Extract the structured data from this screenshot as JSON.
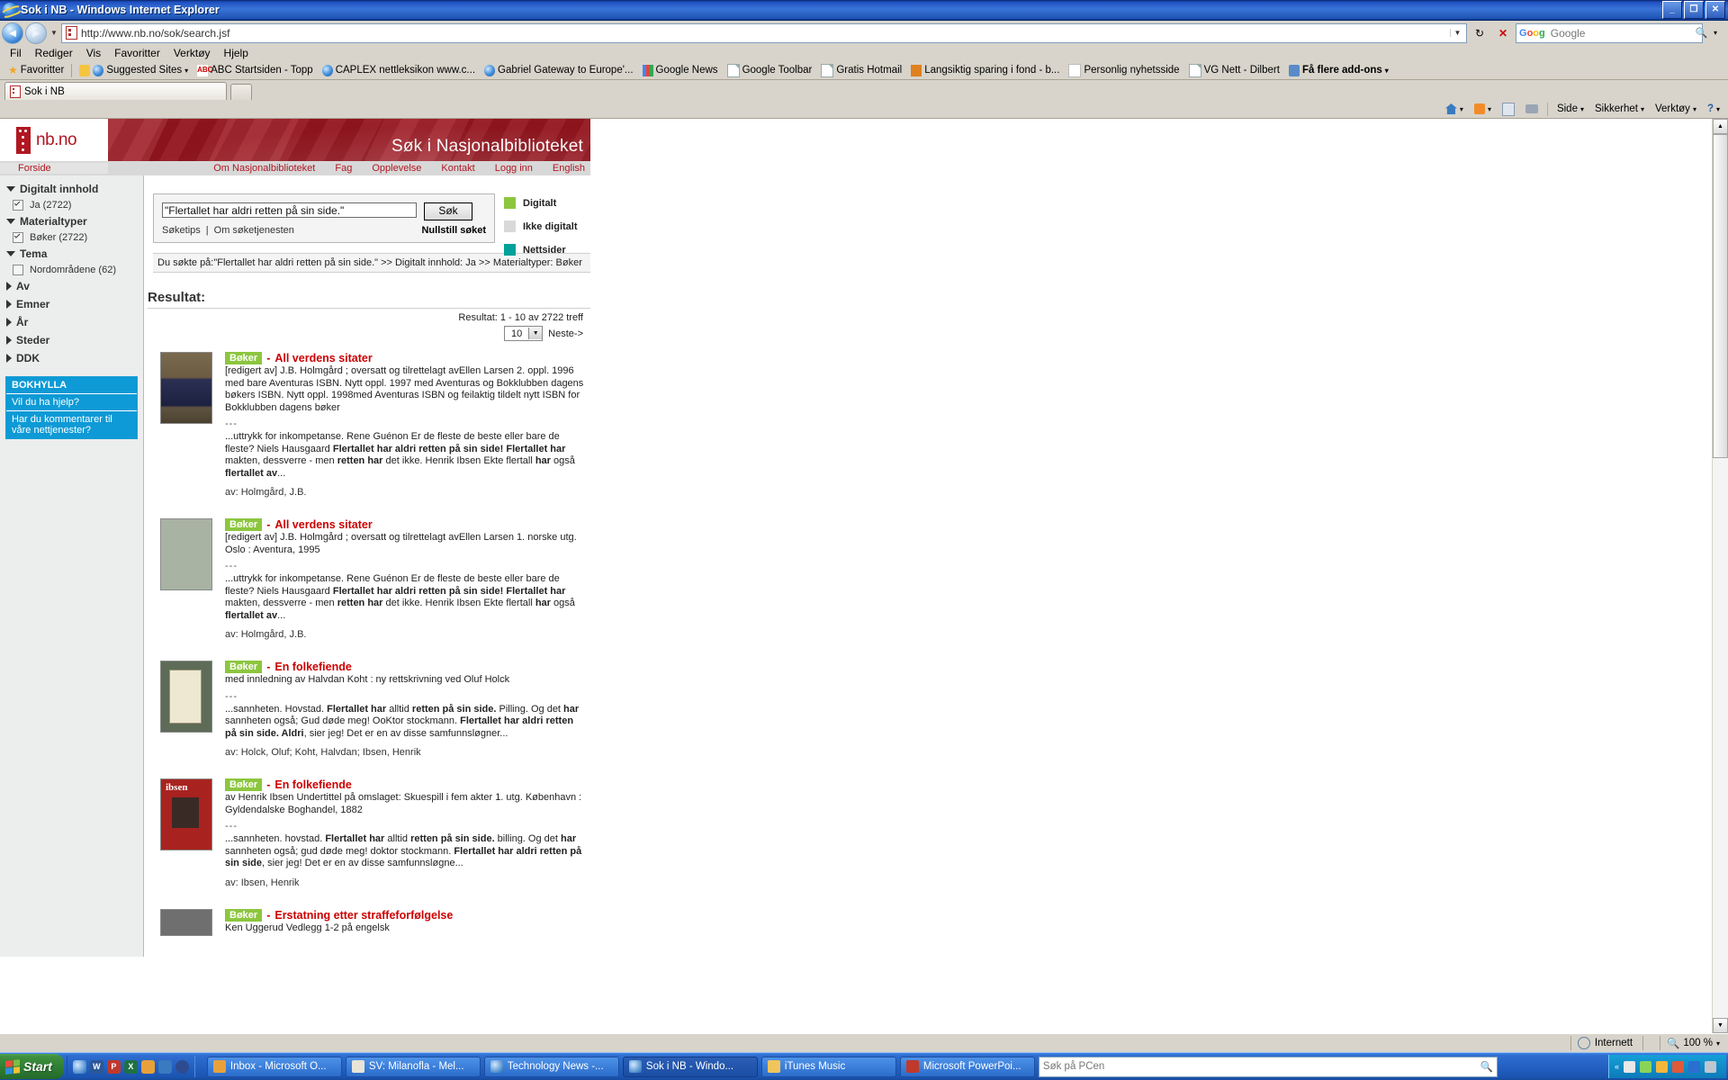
{
  "window": {
    "title": "Sok i NB - Windows Internet Explorer",
    "minimize": "_",
    "maximize": "❐",
    "close": "✕"
  },
  "address": {
    "url_prefix": "http://www.",
    "url_domain": "nb.no",
    "url_path": "/sok/search.jsf",
    "full_url": "http://www.nb.no/sok/search.jsf",
    "dropdown_arrow": "▼",
    "refresh": "↻",
    "stop": "✕"
  },
  "browser_search": {
    "placeholder": "Google",
    "value": "Google"
  },
  "menu": [
    "Fil",
    "Rediger",
    "Vis",
    "Favoritter",
    "Verktøy",
    "Hjelp"
  ],
  "favorites_bar": {
    "favorites_label": "Favoritter",
    "items": [
      {
        "label": "Suggested Sites",
        "icon": "ie-icon",
        "caret": "▾"
      },
      {
        "label": "ABC Startsiden - Topp",
        "icon": "abc-icon"
      },
      {
        "label": "CAPLEX nettleksikon www.c...",
        "icon": "ie-icon"
      },
      {
        "label": "Gabriel  Gateway to Europe'...",
        "icon": "ie-icon"
      },
      {
        "label": "Google News",
        "icon": "google-icon"
      },
      {
        "label": "Google Toolbar",
        "icon": "doc-icon"
      },
      {
        "label": "Gratis Hotmail",
        "icon": "doc-icon"
      },
      {
        "label": "Langsiktig sparing i fond - b...",
        "icon": "hotmail-icon"
      },
      {
        "label": "Personlig nyhetsside",
        "icon": "doc-icon"
      },
      {
        "label": "VG Nett - Dilbert",
        "icon": "doc-icon"
      },
      {
        "label": "Få flere add-ons",
        "icon": "addons-icon",
        "caret": "▾",
        "bold": true
      }
    ]
  },
  "tabs": [
    {
      "label": "Sok i NB",
      "active": true
    }
  ],
  "command_bar": {
    "home": "Side",
    "security": "Sikkerhet",
    "tools": "Verktøy",
    "help_caret": "▾",
    "page_caret": "▾"
  },
  "site": {
    "logo_text": "nb.no",
    "hero_title": "Søk i Nasjonalbiblioteket",
    "nav_left": "Forside",
    "nav_links": [
      "Om Nasjonalbiblioteket",
      "Fag",
      "Opplevelse",
      "Kontakt",
      "Logg inn",
      "English"
    ]
  },
  "sidebar": {
    "groups": [
      {
        "label": "Digitalt innhold",
        "expanded": true,
        "items": [
          {
            "label": "Ja (2722)",
            "checked": true
          }
        ]
      },
      {
        "label": "Materialtyper",
        "expanded": true,
        "items": [
          {
            "label": "Bøker (2722)",
            "checked": true
          }
        ]
      },
      {
        "label": "Tema",
        "expanded": true,
        "items": [
          {
            "label": "Nordområdene (62)",
            "checked": false
          }
        ]
      },
      {
        "label": "Av",
        "expanded": false,
        "items": []
      },
      {
        "label": "Emner",
        "expanded": false,
        "items": []
      },
      {
        "label": "År",
        "expanded": false,
        "items": []
      },
      {
        "label": "Steder",
        "expanded": false,
        "items": []
      },
      {
        "label": "DDK",
        "expanded": false,
        "items": []
      }
    ],
    "bokhylla": {
      "title": "BOKHYLLA",
      "rows": [
        "Vil du ha hjelp?",
        "Har du kommentarer til våre nettjenester?"
      ],
      "color": "#0e9ad6"
    }
  },
  "search": {
    "query_value": "\"Flertallet har aldri retten på sin side.\"",
    "placeholder": "Søk i Nasjonalbiblioteket",
    "submit_label": "Søk",
    "tips_label": "Søketips",
    "divider": "|",
    "about_label": "Om søketjenesten",
    "reset_label": "Nullstill søket"
  },
  "legend": [
    {
      "label": "Digitalt",
      "color": "#8cc63e"
    },
    {
      "label": "Ikke digitalt",
      "color": "#d9d9d9"
    },
    {
      "label": "Nettsider",
      "color": "#00a19a"
    }
  ],
  "breadcrumb": "Du søkte på:\"Flertallet har aldri retten på sin side.\" >> Digitalt innhold: Ja >> Materialtyper: Bøker",
  "results_header": "Resultat:",
  "results_meta": {
    "count_text": "Resultat: 1 - 10 av 2722 treff",
    "per_page": "10",
    "per_page_arrow": "▼",
    "next_label": "Neste->"
  },
  "results": [
    {
      "badge": "Bøker",
      "dash": "-",
      "title": "All verdens sitater",
      "desc": "[redigert av] J.B. Holmgård ; oversatt og tilrettelagt avEllen Larsen 2. oppl. 1996 med bare Aventuras ISBN. Nytt oppl. 1997 med Aventuras og Bokklubben dagens bøkers ISBN. Nytt oppl. 1998med Aventuras ISBN og feilaktig tildelt nytt ISBN for Bokklubben dagens bøker",
      "separator": "---",
      "snippet": "...uttrykk for inkompetanse. Rene Guénon Er de fleste de beste eller bare de fleste? Niels Hausgaard <b>Flertallet har aldri retten på sin side!</b> <b>Flertallet har</b> makten, dessverre - men <b>retten har</b> det ikke. Henrik Ibsen Ekte flertall <b>har</b> også <b>flertallet av</b>...",
      "author": "av: Holmgård, J.B.",
      "cover_style": "cover-1"
    },
    {
      "badge": "Bøker",
      "dash": "-",
      "title": "All verdens sitater",
      "desc": "[redigert av] J.B. Holmgård ; oversatt og tilrettelagt avEllen Larsen 1. norske utg. Oslo : Aventura, 1995",
      "separator": "---",
      "snippet": "...uttrykk for inkompetanse. Rene Guénon Er de fleste de beste eller bare de fleste? Niels Hausgaard <b>Flertallet har aldri retten på sin side!</b> <b>Flertallet har</b> makten, dessverre - men <b>retten har</b> det ikke. Henrik Ibsen Ekte flertall <b>har</b> også <b>flertallet av</b>...",
      "author": "av: Holmgård, J.B.",
      "cover_style": "cover-2"
    },
    {
      "badge": "Bøker",
      "dash": "-",
      "title": "En folkefiende",
      "desc": "med innledning av Halvdan Koht : ny rettskrivning ved Oluf Holck",
      "separator": "---",
      "snippet": "...sannheten. Hovstad. <b>Flertallet har</b> alltid <b>retten på sin side.</b> Pilling. Og det <b>har</b> sannheten også; Gud døde meg! OoKtor stockmann. <b>Flertallet har aldri retten på sin side. Aldri</b>, sier jeg! Det er en av disse samfunnsløgner...",
      "author": "av: Holck, Oluf; Koht, Halvdan; Ibsen, Henrik",
      "cover_style": "cover-3"
    },
    {
      "badge": "Bøker",
      "dash": "-",
      "title": "En folkefiende",
      "desc": "av Henrik Ibsen Undertittel på omslaget: Skuespill i fem akter 1. utg. København : Gyldendalske Boghandel, 1882",
      "separator": "---",
      "snippet": "...sannheten. hovstad. <b>Flertallet har</b> alltid <b>retten på sin side.</b> billing. Og det <b>har</b> sannheten også; gud døde meg! doktor stockmann. <b>Flertallet har aldri retten på sin side</b>, sier jeg! Det er en av disse samfunnsløgne...",
      "author": "av: Ibsen, Henrik",
      "cover_style": "cover-4"
    },
    {
      "badge": "Bøker",
      "dash": "-",
      "title": "Erstatning etter straffeforfølgelse",
      "desc": "Ken Uggerud Vedlegg 1-2 på engelsk",
      "separator": "",
      "snippet": "",
      "author": "",
      "cover_style": "cover-5"
    }
  ],
  "status_bar": {
    "left": "",
    "zone": "Internett",
    "zoom": "100 %",
    "zoom_caret": "▾"
  },
  "taskbar": {
    "start": "Start",
    "tasks": [
      {
        "label": "Inbox - Microsoft O...",
        "icon": "outlook-icon",
        "active": false
      },
      {
        "label": "SV: Milanofla - Mel...",
        "icon": "mail-icon",
        "active": false
      },
      {
        "label": "Technology News -...",
        "icon": "ie-icon",
        "active": false
      },
      {
        "label": "Sok i NB - Windo...",
        "icon": "ie-icon",
        "active": true
      },
      {
        "label": "iTunes Music",
        "icon": "folder-icon",
        "active": false
      },
      {
        "label": "Microsoft PowerPoi...",
        "icon": "ppt-icon",
        "active": false
      }
    ],
    "search_placeholder": "Søk på PCen",
    "tray_time": ""
  }
}
